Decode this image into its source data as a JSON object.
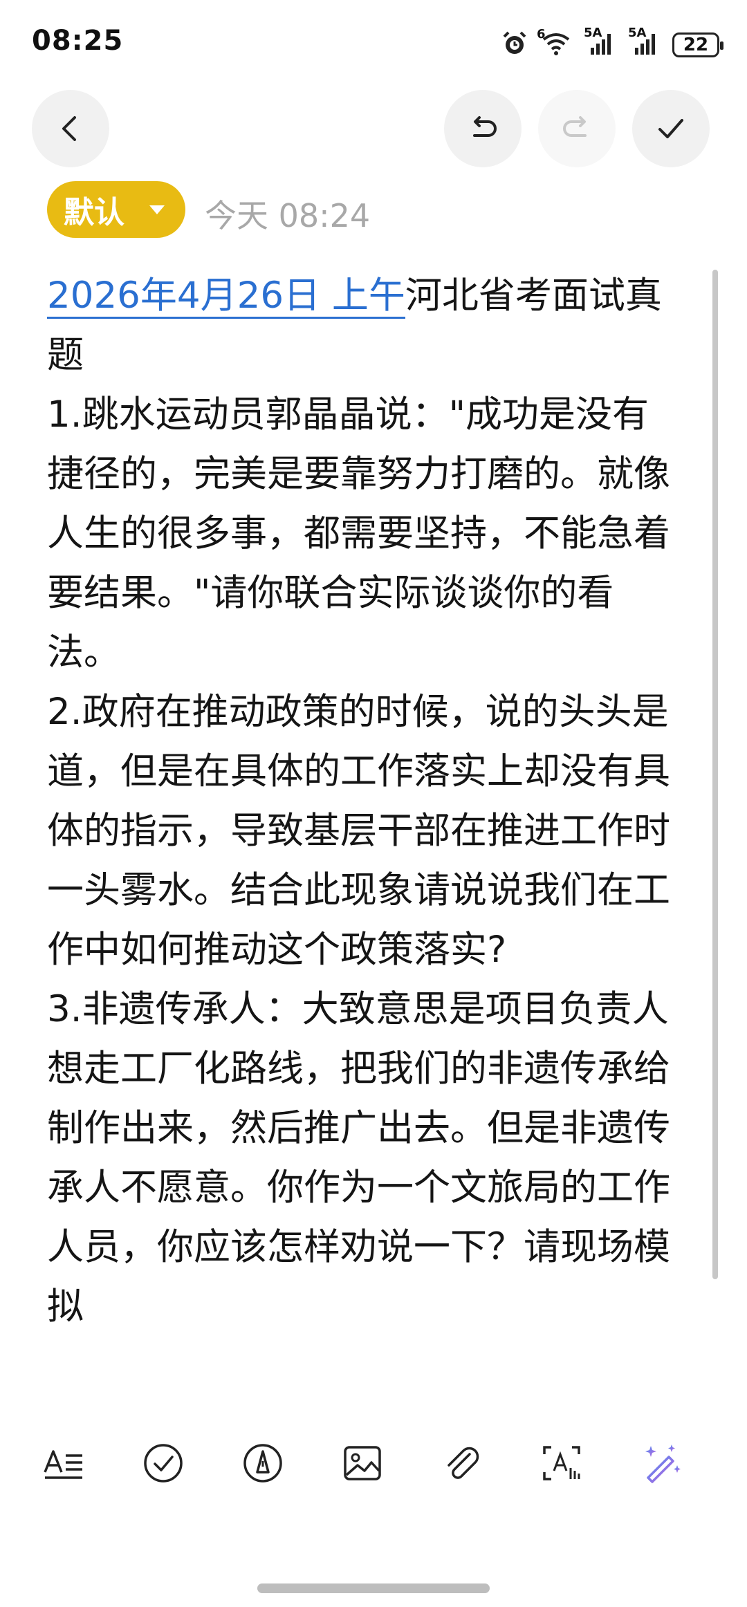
{
  "status_bar": {
    "time": "08:25",
    "network_a": "6",
    "network_b": "5A",
    "network_c": "5A",
    "battery": "22",
    "icons": [
      "alarm-icon",
      "wifi-icon",
      "signal-icon",
      "signal-icon",
      "battery-icon"
    ]
  },
  "toolbar": {
    "icons": [
      "back-icon",
      "undo-icon",
      "redo-icon",
      "check-icon"
    ]
  },
  "meta": {
    "category": "默认",
    "timestamp": "今天 08:24"
  },
  "note": {
    "date_link": "2026年4月26日 上午",
    "title_rest": "河北省考面试真题",
    "paragraphs": [
      "1.跳水运动员郭晶晶说：\"成功是没有捷径的，完美是要靠努力打磨的。就像人生的很多事，都需要坚持，不能急着要结果。\"请你联合实际谈谈你的看法。",
      "2.政府在推动政策的时候，说的头头是道，但是在具体的工作落实上却没有具体的指示，导致基层干部在推进工作时一头雾水。结合此现象请说说我们在工作中如何推动这个政策落实?",
      "3.非遗传承人：大致意思是项目负责人想走工厂化路线，把我们的非遗传承给制作出来，然后推广出去。但是非遗传承人不愿意。你作为一个文旅局的工作人员，你应该怎样劝说一下？请现场模拟"
    ]
  },
  "bottom_toolbar": {
    "icons": [
      "text-format-icon",
      "checklist-icon",
      "pen-icon",
      "image-icon",
      "attachment-icon",
      "scan-text-icon",
      "ai-magic-icon"
    ]
  },
  "colors": {
    "accent": "#e8bb13",
    "link": "#2a6fd1",
    "muted": "#a8a8a8"
  }
}
